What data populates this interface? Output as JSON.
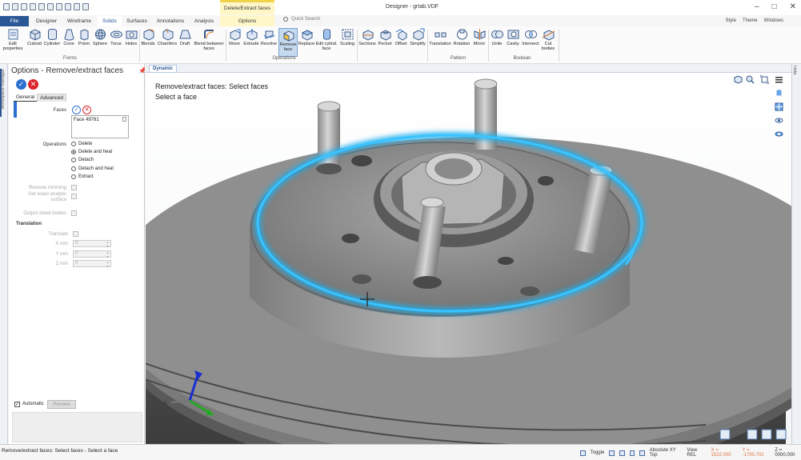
{
  "window": {
    "title": "Designer - grtab.VDF",
    "context_tab_header": "Delete/Extract faces",
    "controls": [
      "–",
      "□",
      "✕"
    ]
  },
  "tabs": [
    "File",
    "Designer",
    "Wireframe",
    "Solids",
    "Surfaces",
    "Annotations",
    "Analysis",
    "Options"
  ],
  "quick_search": "Quick Search",
  "top_right_menus": [
    "Style",
    "Theme",
    "Windows"
  ],
  "ribbon": {
    "buttons": [
      "Edit properties",
      "Cuboid",
      "Cylinder",
      "Cone",
      "Prism",
      "Sphere",
      "Torus",
      "Holes",
      "Blends",
      "Chamfers",
      "Draft",
      "Blend between faces",
      "Move",
      "Extrude",
      "Revolve",
      "Remove face",
      "Replace",
      "Edit cylind. face",
      "Scaling",
      "Sections",
      "Pocket",
      "Offset",
      "Simplify",
      "Translation",
      "Rotation",
      "Mirror",
      "Unite",
      "Cavity",
      "Intersect",
      "Cut bodies"
    ],
    "groups": [
      "Forms",
      "Operations",
      "Pattern",
      "Boolean"
    ],
    "selected_button": "Remove face"
  },
  "side_strip_label": "Workspace manager",
  "panel": {
    "title": "Options - Remove/extract faces",
    "pin": "📌",
    "ok": "✓",
    "cancel": "✕",
    "tabs": [
      "General",
      "Advanced"
    ],
    "faces_label": "Faces",
    "faces_list": [
      "Face 49781"
    ],
    "operations_label": "Operations",
    "operations": [
      "Delete",
      "Delete and heal",
      "Detach",
      "Detach and heal",
      "Extract"
    ],
    "operations_selected": "Delete and heal",
    "remove_trimming": "Remove trimming",
    "get_analytic_1": "Get exact analytic",
    "get_analytic_2": "surface",
    "output_sheet": "Output sheet bodies",
    "translation_header": "Translation",
    "translate": "Translate",
    "x_label": "X mm",
    "y_label": "Y mm",
    "z_label": "Z mm",
    "x_value": "0",
    "y_value": "0",
    "z_value": "0",
    "automatic": "Automatic",
    "preview": "Preview"
  },
  "viewport": {
    "tab": "Dynamic",
    "prompt_line1": "Remove/extract faces: Select faces",
    "prompt_line2": "Select a face",
    "axis_label": "X",
    "highlight_color": "#1ab0f0"
  },
  "right_strip_label": "Help",
  "status": {
    "text": "Remove/extract faces: Select faces - Select a face",
    "toggle": "Toggle",
    "plane": "Absolute XY Top",
    "view": "View REL",
    "x_coord": "X = 1522.000",
    "y_coord": "Y = -1700.702",
    "z_coord": "Z = 0000.000"
  }
}
